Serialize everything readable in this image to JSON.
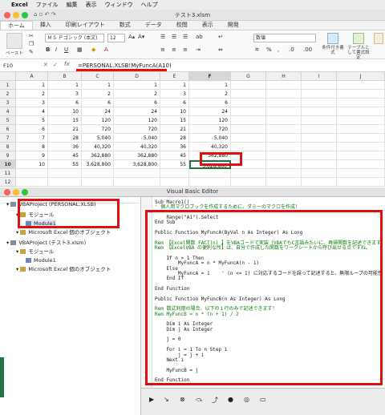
{
  "menubar": {
    "apple": "",
    "app": "Excel",
    "items": [
      "ファイル",
      "編集",
      "表示",
      "ウィンドウ",
      "ヘルプ"
    ]
  },
  "window": {
    "title": "テスト3.xlsm"
  },
  "ribbon": {
    "tabs": [
      "ホーム",
      "挿入",
      "印刷レイアウト",
      "数式",
      "データ",
      "校閲",
      "表示",
      "開発"
    ],
    "paste_label": "ペースト",
    "font_name": "ＭＳ Ｐゴシック (本文)",
    "font_size": "12",
    "number_format": "数値",
    "percent": "%",
    "cond_format": "条件付き書式",
    "table_format": "テーブルとして書式設定",
    "cell_styles": "セルのスタイル"
  },
  "formulabar": {
    "name_box": "F10",
    "fx": "fx",
    "formula": "=PERSONAL.XLSB!MyFuncA(A10)"
  },
  "sheet": {
    "columns": [
      "A",
      "B",
      "C",
      "D",
      "E",
      "F",
      "G",
      "H",
      "I",
      "J"
    ],
    "rows": [
      [
        "1",
        "1",
        "1",
        "1",
        "1",
        "1"
      ],
      [
        "2",
        "3",
        "2",
        "2",
        "3",
        "2"
      ],
      [
        "3",
        "6",
        "6",
        "6",
        "6",
        "6"
      ],
      [
        "4",
        "10",
        "24",
        "24",
        "10",
        "24"
      ],
      [
        "5",
        "15",
        "120",
        "120",
        "15",
        "120"
      ],
      [
        "6",
        "21",
        "720",
        "720",
        "21",
        "720"
      ],
      [
        "7",
        "28",
        "5,040",
        "5,040",
        "28",
        "5,040"
      ],
      [
        "8",
        "36",
        "40,320",
        "40,320",
        "36",
        "40,320"
      ],
      [
        "9",
        "45",
        "362,880",
        "362,880",
        "45",
        "362,880"
      ],
      [
        "10",
        "55",
        "3,628,800",
        "3,628,800",
        "55",
        "3,628,800"
      ]
    ],
    "active_row": "10"
  },
  "vbe": {
    "title": "Visual Basic Editor",
    "tree": [
      {
        "label": "VBAProject (PERSONAL.XLSB)",
        "level": 0
      },
      {
        "label": "モジュール",
        "level": 1
      },
      {
        "label": "Module1",
        "level": 2
      },
      {
        "label": "Microsoft Excel 個のオブジェクト",
        "level": 1
      },
      {
        "label": "VBAProject (テスト3.xlsm)",
        "level": 0
      },
      {
        "label": "モジュール",
        "level": 1
      },
      {
        "label": "Module1",
        "level": 2
      },
      {
        "label": "Microsoft Excel 個のオブジェクト",
        "level": 1
      }
    ],
    "code_lines": [
      {
        "t": "Sub Macro1()",
        "c": false
      },
      {
        "t": "' 個人用マクロブックを作成するために、ダミーのマクロを作成！",
        "c": true
      },
      {
        "t": "",
        "c": false
      },
      {
        "t": "    Range(\"A1\").Select",
        "c": false
      },
      {
        "t": "End Sub",
        "c": false
      },
      {
        "t": "",
        "c": false
      },
      {
        "t": "Public Function MyFuncA(ByVal n As Integer) As Long",
        "c": false
      },
      {
        "t": "",
        "c": false
      },
      {
        "t": "Rem 【Excel関数 FACT(n) 】をVBAコードで実装（VBAでもC言語みたいに、再帰関数を記述できます！）",
        "c": true
      },
      {
        "t": "Rem 【ExcelVBA の便利な所】は、自分で作成した関数をワークシートから呼び出せる点ですね。",
        "c": true
      },
      {
        "t": "",
        "c": false
      },
      {
        "t": "    If n > 1 Then",
        "c": false
      },
      {
        "t": "        MyFuncA = n * MyFuncA(n - 1)",
        "c": false
      },
      {
        "t": "    Else",
        "c": false
      },
      {
        "t": "        MyFuncA = 1    ' (n <= 1) に対応するコードを誤って記述すると、無限ループの可能性",
        "c": false
      },
      {
        "t": "    End If",
        "c": false
      },
      {
        "t": "",
        "c": false
      },
      {
        "t": "End Function",
        "c": false
      },
      {
        "t": "",
        "c": false
      },
      {
        "t": "Public Function MyFuncB(n As Integer) As Long",
        "c": false
      },
      {
        "t": "",
        "c": false
      },
      {
        "t": "Rem 数式利用の場合、以下の１行のみで記述できます！",
        "c": true
      },
      {
        "t": "Rem MyFuncB = n * (n + 1) / 2",
        "c": true
      },
      {
        "t": "",
        "c": false
      },
      {
        "t": "    Dim i As Integer",
        "c": false
      },
      {
        "t": "    Dim j As Integer",
        "c": false
      },
      {
        "t": "",
        "c": false
      },
      {
        "t": "    j = 0",
        "c": false
      },
      {
        "t": "",
        "c": false
      },
      {
        "t": "    For i = 1 To n Step 1",
        "c": false
      },
      {
        "t": "        j = j + i",
        "c": false
      },
      {
        "t": "    Next i",
        "c": false
      },
      {
        "t": "",
        "c": false
      },
      {
        "t": "    MyFuncB = j",
        "c": false
      },
      {
        "t": "",
        "c": false
      },
      {
        "t": "End Function",
        "c": false
      }
    ]
  },
  "colors": {
    "highlight": "#e01010",
    "excel_green": "#217346",
    "keyword": "#0a0aa8",
    "comment": "#0a7a0a"
  }
}
